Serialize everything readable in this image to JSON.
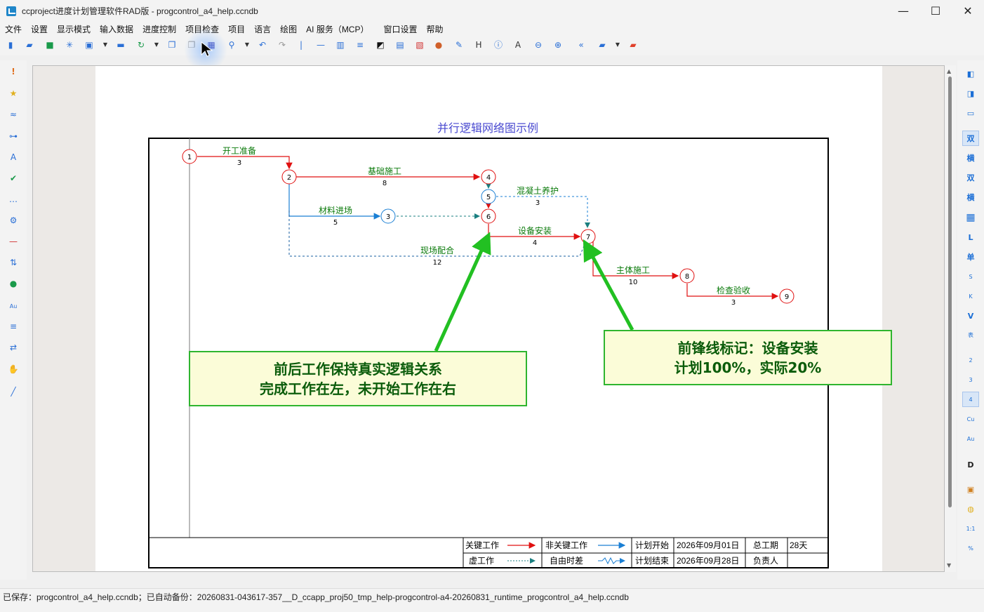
{
  "window": {
    "title": "ccproject进度计划管理软件RAD版 - progcontrol_a4_help.ccndb",
    "minimize": "—",
    "maximize": "☐",
    "close": "✕"
  },
  "menu": [
    "文件",
    "设置",
    "显示模式",
    "输入数据",
    "进度控制",
    "项目检查",
    "项目",
    "语言",
    "绘图",
    "AI 服务（MCP）",
    "窗口设置",
    "帮助"
  ],
  "toolbar_icons": [
    "new-file-icon",
    "open-folder-icon",
    "save-icon",
    "asterisk-icon",
    "export-image-icon",
    "dropdown-icon",
    "print-icon",
    "refresh-icon",
    "dropdown-icon",
    "copy-icon",
    "paste-icon",
    "save-disk-icon",
    "search-icon",
    "dropdown-icon",
    "undo-icon",
    "redo-icon",
    "separator-icon",
    "line-icon",
    "columns-icon",
    "sort-icon",
    "contrast-icon",
    "paint-icon",
    "report-icon",
    "palette-icon",
    "edit-icon",
    "h-icon",
    "info-icon",
    "a-text-icon",
    "zoom-out-icon",
    "zoom-in-icon",
    "back-icon",
    "folder-icon",
    "dropdown-icon",
    "red-folder-icon"
  ],
  "left_icons": [
    "exclamation-icon",
    "star-icon",
    "wave-icon",
    "link-icon",
    "font-a-icon",
    "check-icon",
    "dots-icon",
    "gear-icon",
    "minus-icon",
    "sort-icon",
    "users-icon",
    "au-icon",
    "filter-icon",
    "swap-icon",
    "hand-icon",
    "pen-icon"
  ],
  "right_tools": [
    {
      "label": "◧",
      "icon": "panel-left-icon"
    },
    {
      "label": "◨",
      "icon": "panel-right-icon"
    },
    {
      "label": "▭",
      "icon": "panel-bottom-icon"
    },
    {
      "label": "双",
      "icon": "double-icon",
      "selected": true
    },
    {
      "label": "横",
      "icon": "horizontal-icon"
    },
    {
      "label": "双",
      "icon": "double-plus-icon"
    },
    {
      "label": "横",
      "icon": "horizontal-plus-icon"
    },
    {
      "label": "▦",
      "icon": "table-icon"
    },
    {
      "label": "L",
      "icon": "l-icon"
    },
    {
      "label": "单",
      "icon": "single-icon"
    },
    {
      "label": "S",
      "icon": "s-icon"
    },
    {
      "label": "K",
      "icon": "k-icon"
    },
    {
      "label": "V",
      "icon": "v-icon"
    },
    {
      "label": "表",
      "icon": "biao-icon"
    },
    {
      "label": "2",
      "icon": "num2-icon"
    },
    {
      "label": "3",
      "icon": "num3-icon"
    },
    {
      "label": "4",
      "icon": "num4-icon",
      "selected": true
    },
    {
      "label": "Cu",
      "icon": "cu-icon"
    },
    {
      "label": "Au",
      "icon": "au-icon"
    },
    {
      "label": "D",
      "icon": "d-icon"
    },
    {
      "label": "▣",
      "icon": "frame-icon"
    },
    {
      "label": "◍",
      "icon": "comment-icon"
    },
    {
      "label": "1:1",
      "icon": "ratio-icon"
    },
    {
      "label": "%",
      "icon": "percent-icon"
    }
  ],
  "diagram": {
    "title": "并行逻辑网络图示例",
    "nodes": [
      "1",
      "2",
      "3",
      "4",
      "5",
      "6",
      "7",
      "8",
      "9"
    ],
    "activities": [
      {
        "name": "开工准备",
        "duration": "3"
      },
      {
        "name": "基础施工",
        "duration": "8"
      },
      {
        "name": "材料进场",
        "duration": "5"
      },
      {
        "name": "混凝土养护",
        "duration": "3"
      },
      {
        "name": "设备安装",
        "duration": "4"
      },
      {
        "name": "现场配合",
        "duration": "12"
      },
      {
        "name": "主体施工",
        "duration": "10"
      },
      {
        "name": "检查验收",
        "duration": "3"
      }
    ],
    "legend": {
      "critical": "关键工作",
      "noncritical": "非关键工作",
      "dummy": "虚工作",
      "float": "自由时差",
      "plan_start_label": "计划开始",
      "plan_start": "2026年09月01日",
      "plan_end_label": "计划结束",
      "plan_end": "2026年09月28日",
      "duration_label": "总工期",
      "duration": "28天",
      "owner_label": "负责人",
      "owner": ""
    },
    "colors": {
      "critical": "#e01010",
      "noncritical": "#1a7fd4",
      "dummy": "#1a7f80",
      "title": "#4a4ad0"
    }
  },
  "callouts": {
    "left_line1": "前后工作保持真实逻辑关系",
    "left_line2": "完成工作在左，未开始工作在右",
    "right_line1": "前锋线标记：设备安装",
    "right_line2": "计划100%，实际20%"
  },
  "status": "已保存：progcontrol_a4_help.ccndb；已自动备份：20260831-043617-357__D_ccapp_proj50_tmp_help-progcontrol-a4-20260831_runtime_progcontrol_a4_help.ccndb"
}
